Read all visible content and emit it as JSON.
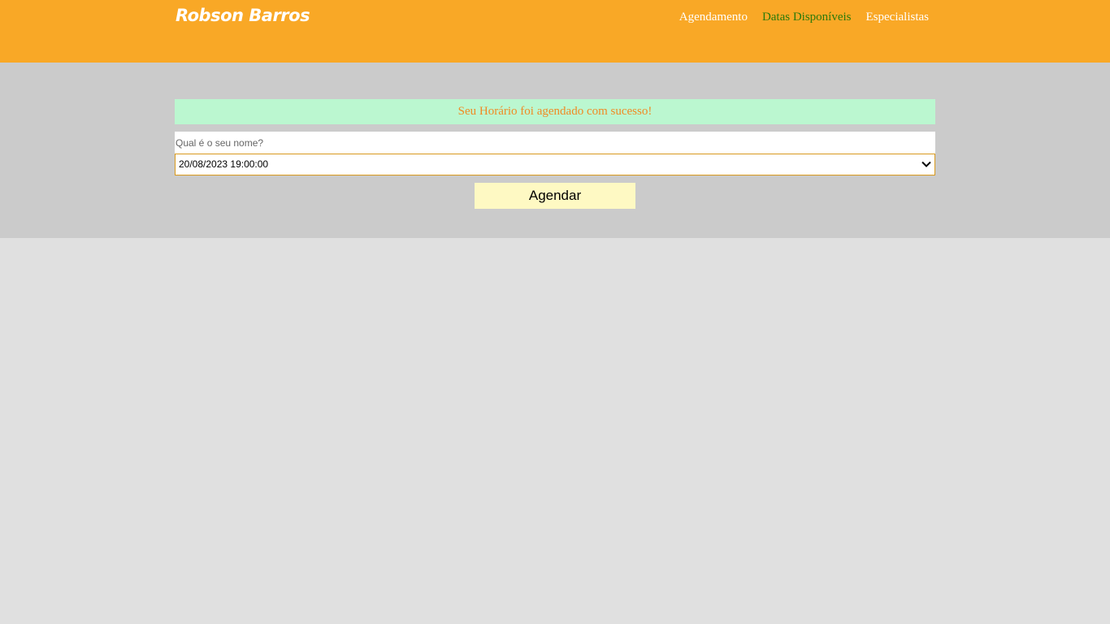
{
  "header": {
    "brand": "Robson Barros",
    "nav": [
      {
        "label": "Agendamento",
        "active": false
      },
      {
        "label": "Datas Disponíveis",
        "active": true
      },
      {
        "label": "Especialistas",
        "active": false
      }
    ]
  },
  "alert": {
    "message": "Seu Horário foi agendado com sucesso!"
  },
  "form": {
    "name_placeholder": "Qual é o seu nome?",
    "name_value": "",
    "selected_datetime": "20/08/2023 19:00:00",
    "submit_label": "Agendar"
  },
  "colors": {
    "header_bg": "#f9a826",
    "panel_bg": "#cbcbcb",
    "page_bg": "#e0e0e0",
    "alert_bg": "#bbf7d0",
    "alert_text": "#f08a24",
    "active_nav": "#2b7a0b",
    "button_bg": "#fef9c3"
  },
  "icons": {
    "select_arrow": "chevron-down-icon"
  }
}
